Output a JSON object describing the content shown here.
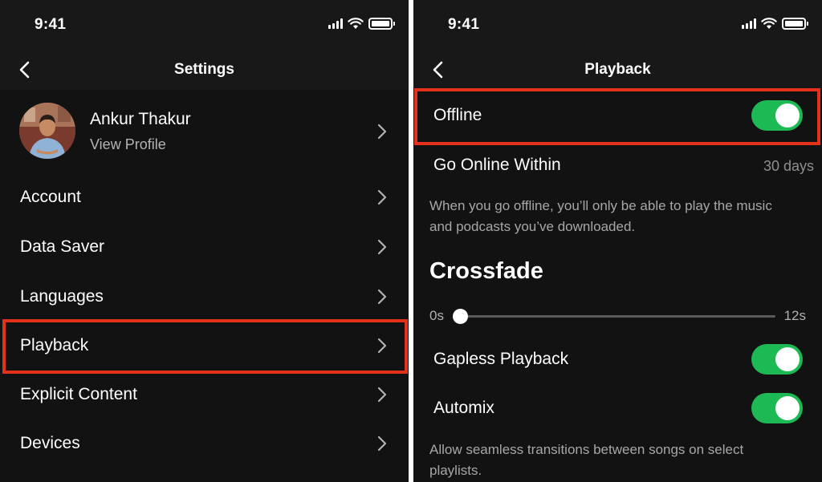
{
  "status_bar": {
    "time": "9:41"
  },
  "settings_screen": {
    "title": "Settings",
    "profile": {
      "name": "Ankur Thakur",
      "subtitle": "View Profile"
    },
    "items": [
      {
        "label": "Account"
      },
      {
        "label": "Data Saver"
      },
      {
        "label": "Languages"
      },
      {
        "label": "Playback",
        "highlighted": true
      },
      {
        "label": "Explicit Content"
      },
      {
        "label": "Devices"
      }
    ]
  },
  "playback_screen": {
    "title": "Playback",
    "offline": {
      "label": "Offline",
      "enabled": true,
      "highlighted": true
    },
    "go_online": {
      "label": "Go Online Within",
      "value": "30 days"
    },
    "offline_description": "When you go offline, you’ll only be able to play the music and podcasts you’ve downloaded.",
    "crossfade": {
      "title": "Crossfade",
      "min_label": "0s",
      "max_label": "12s",
      "value_seconds": 0
    },
    "gapless": {
      "label": "Gapless Playback",
      "enabled": true
    },
    "automix": {
      "label": "Automix",
      "enabled": true
    },
    "automix_description": "Allow seamless transitions between songs on select playlists."
  },
  "colors": {
    "accent_green": "#1db954",
    "highlight_red": "#e3311b",
    "background": "#121212",
    "header": "#181818"
  },
  "icons": [
    "back-chevron-icon",
    "chevron-right-icon",
    "signal-icon",
    "wifi-icon",
    "battery-icon"
  ]
}
